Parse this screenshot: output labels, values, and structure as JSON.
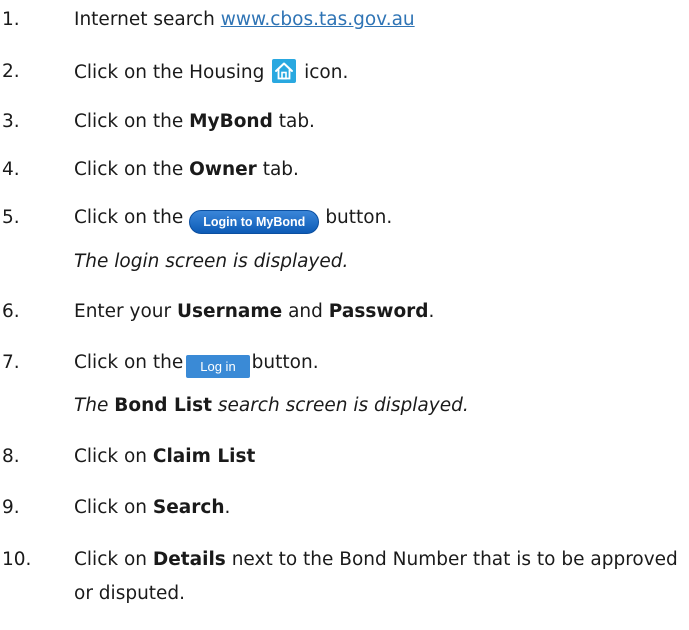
{
  "steps": [
    {
      "num": "1.",
      "prefix": "Internet search ",
      "link": "www.cbos.tas.gov.au"
    },
    {
      "num": "2.",
      "prefix": "Click on the Housing",
      "icon": "home-icon",
      "suffix": "icon."
    },
    {
      "num": "3.",
      "prefix": "Click on the ",
      "bold": "MyBond",
      "suffix": " tab."
    },
    {
      "num": "4.",
      "prefix": "Click on the ",
      "bold": "Owner",
      "suffix": " tab."
    },
    {
      "num": "5.",
      "prefix": "Click on the",
      "button_label": "Login to MyBond",
      "suffix": "button.",
      "note": "The login screen is displayed."
    },
    {
      "num": "6.",
      "prefix": " Enter your ",
      "bold": "Username",
      "middle": " and ",
      "bold2": "Password",
      "suffix": "."
    },
    {
      "num": "7.",
      "prefix": "Click on the",
      "button_label": "Log in",
      "suffix": "button.",
      "note_prefix": "The ",
      "note_bold": "Bond List",
      "note_suffix": " search screen is displayed."
    },
    {
      "num": "8.",
      "prefix": " Click on ",
      "bold": "Claim List"
    },
    {
      "num": "9.",
      "prefix": "Click on ",
      "bold": "Search",
      "suffix": "."
    },
    {
      "num": "10.",
      "prefix": "Click on ",
      "bold": "Details",
      "suffix": " next to the Bond Number that is to be approved or disputed."
    }
  ],
  "colors": {
    "link": "#2f74b5",
    "mybond_button": "#0d5bb6",
    "login_button": "#3a8ad6",
    "home_icon": "#29a8e0"
  }
}
